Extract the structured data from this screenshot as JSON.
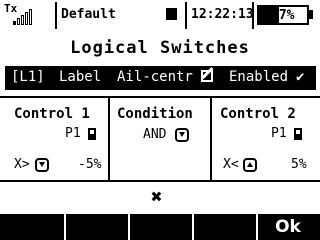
{
  "status": {
    "tx_label": "Tx",
    "model_name": "Default",
    "time": "12:22:13",
    "battery": "57%"
  },
  "page": {
    "title": "Logical Switches"
  },
  "switch_row": {
    "id": "[L1]",
    "label_key": "Label",
    "label_value": "Ail-centr",
    "state": "Enabled",
    "check": "✔"
  },
  "control1": {
    "header": "Control 1",
    "source": "P1",
    "compare": "X>",
    "value": "-5%"
  },
  "condition": {
    "header": "Condition",
    "value": "AND"
  },
  "control2": {
    "header": "Control 2",
    "source": "P1",
    "compare": "X<",
    "value": "5%"
  },
  "close_glyph": "✖",
  "bottom": {
    "ok_label": "Ok"
  }
}
